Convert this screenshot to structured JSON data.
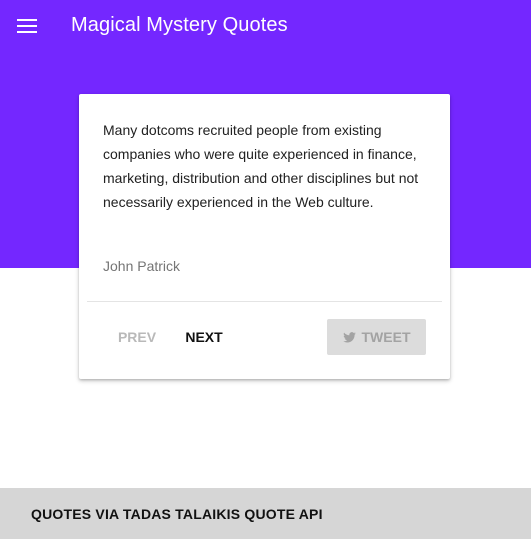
{
  "app_bar": {
    "title": "Magical Mystery Quotes",
    "color": "#7427ff"
  },
  "card": {
    "quote": "Many dotcoms recruited people from existing companies who were quite experienced in finance, marketing, distribution and other disciplines but not necessarily experienced in the Web culture.",
    "author": "John Patrick",
    "prev_label": "PREV",
    "next_label": "NEXT",
    "tweet_label": "TWEET",
    "tweet_icon": "twitter-bird-icon",
    "menu_icon": "hamburger-menu-icon"
  },
  "footer": {
    "text": "QUOTES VIA TADAS TALAIKIS QUOTE API"
  }
}
